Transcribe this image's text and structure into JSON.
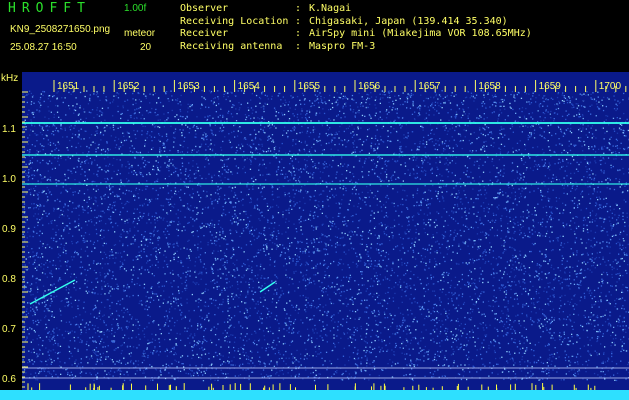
{
  "header": {
    "app_title": "HROFFT",
    "version": "1.00f",
    "filename": "KN9_2508271650.png",
    "datetime": "25.08.27 16:50",
    "mode": "meteor",
    "count": "20"
  },
  "station": [
    {
      "key": "Observer",
      "value": "K.Nagai"
    },
    {
      "key": "Receiving Location",
      "value": "Chigasaki, Japan (139.414 35.340)"
    },
    {
      "key": "Receiver",
      "value": "AirSpy mini (Miakejima VOR 108.65MHz)"
    },
    {
      "key": "Receiving antenna",
      "value": "Maspro FM-3"
    }
  ],
  "spectrogram": {
    "unit": "kHz",
    "time_labels": [
      "1651",
      "1652",
      "1653",
      "1654",
      "1655",
      "1656",
      "1657",
      "1658",
      "1659",
      "1700"
    ],
    "freq_labels": [
      "1.1",
      "1.0",
      "0.9",
      "0.8",
      "0.7",
      "0.6"
    ],
    "colors": {
      "background": "#0a1a8a",
      "noise": "#3a6ae0",
      "signal": "#33ffee",
      "baseline": "#2ee0ff"
    }
  }
}
